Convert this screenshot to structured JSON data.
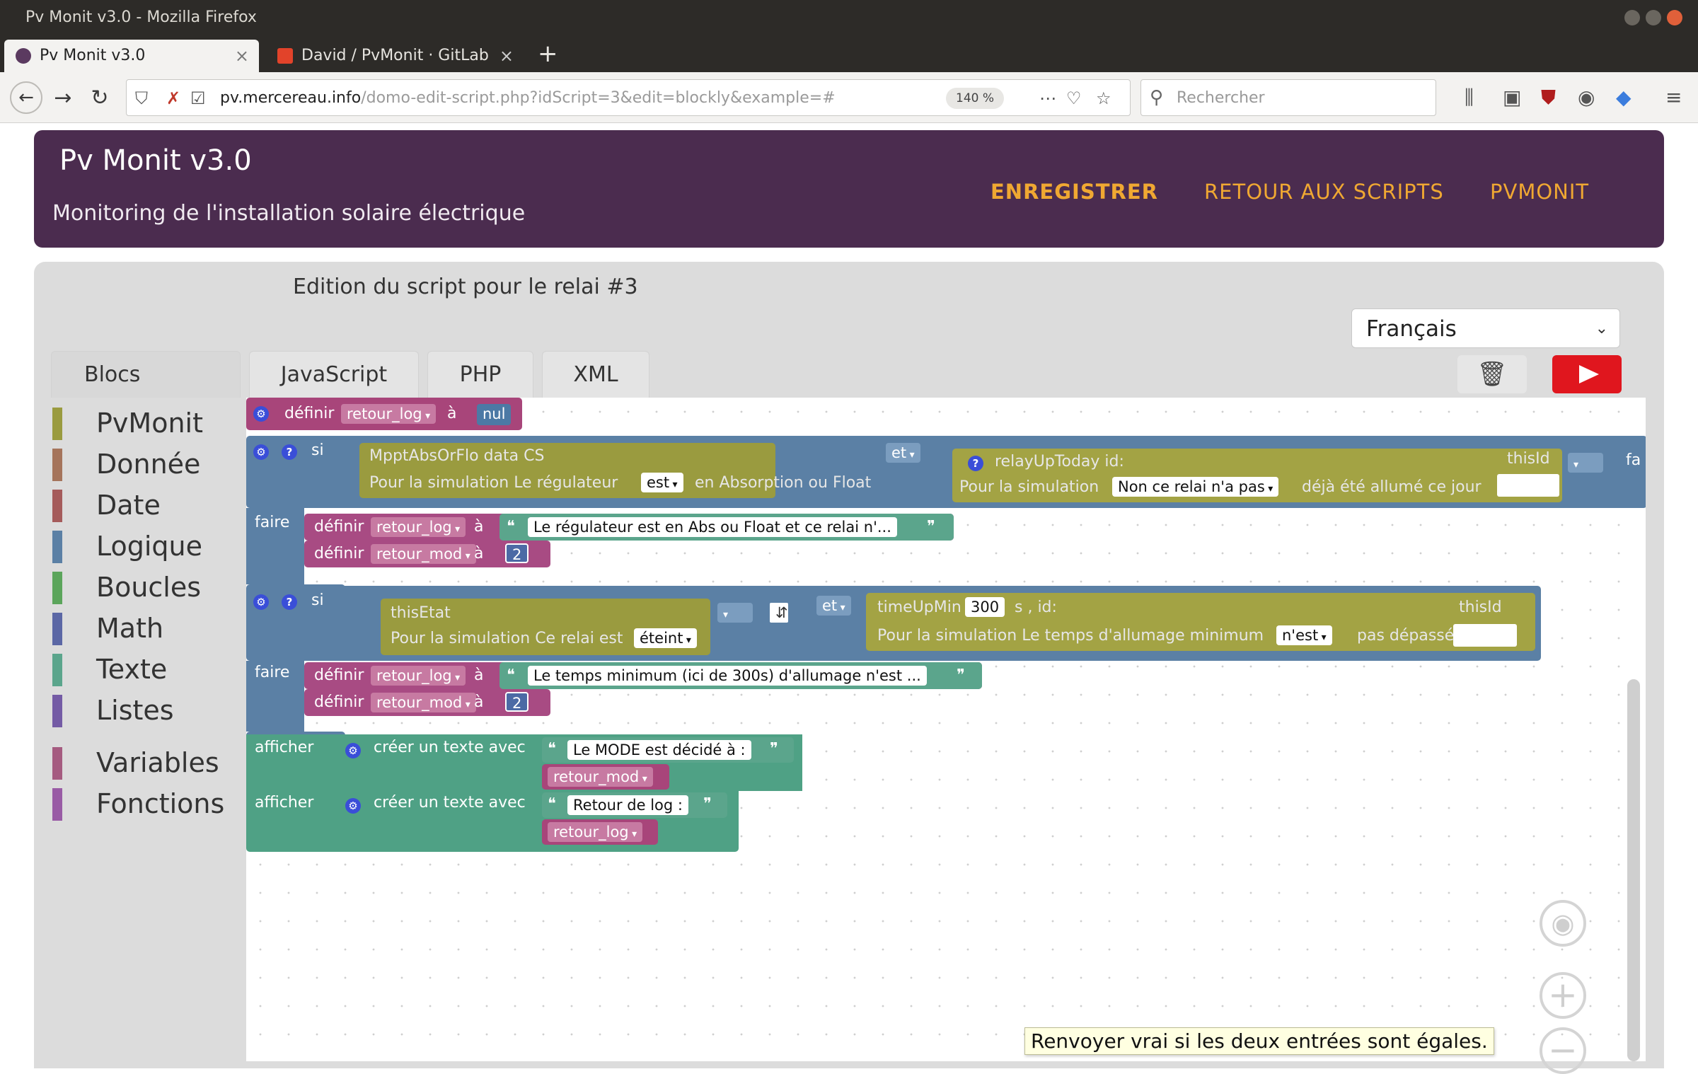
{
  "browser": {
    "window_title": "Pv Monit v3.0 - Mozilla Firefox",
    "tabs": [
      {
        "label": "Pv Monit v3.0",
        "active": true
      },
      {
        "label": "David / PvMonit · GitLab",
        "active": false
      }
    ],
    "url_domain": "pv.mercereau.info",
    "url_prefix": "",
    "url_path": "/domo-edit-script.php?idScript=3&edit=blockly&example=#",
    "zoom": "140 %",
    "search_placeholder": "Rechercher",
    "accent_colors": {
      "window_close": "#e0603a"
    }
  },
  "header": {
    "title": "Pv Monit v3.0",
    "subtitle": "Monitoring de l'installation solaire électrique",
    "nav": {
      "save": "ENREGISTRER",
      "back": "RETOUR AUX SCRIPTS",
      "home": "PVMONIT"
    },
    "bg_color": "#4b2c4f",
    "nav_color": "#f0a832"
  },
  "editor": {
    "script_title": "Edition du script pour le relai #3",
    "language": "Français",
    "tabs": {
      "blocs": "Blocs",
      "js": "JavaScript",
      "php": "PHP",
      "xml": "XML"
    },
    "run_color": "#e0161e"
  },
  "toolbox": {
    "categories": [
      {
        "label": "PvMonit",
        "color": "#9a9b3f"
      },
      {
        "label": "Donnée",
        "color": "#a5745b"
      },
      {
        "label": "Date",
        "color": "#a55b5b"
      },
      {
        "label": "Logique",
        "color": "#5b80a5"
      },
      {
        "label": "Boucles",
        "color": "#5ba55b"
      },
      {
        "label": "Math",
        "color": "#5b67a5"
      },
      {
        "label": "Texte",
        "color": "#5ba58c"
      },
      {
        "label": "Listes",
        "color": "#745ba5"
      },
      {
        "label": "Variables",
        "color": "#a55b80"
      },
      {
        "label": "Fonctions",
        "color": "#995ba5"
      }
    ]
  },
  "blocks": {
    "set1": {
      "definir": "définir",
      "var": "retour_log",
      "a": "à",
      "value": "nul"
    },
    "if1": {
      "si": "si",
      "faire": "faire",
      "cond_a_title": "MpptAbsOrFlo  data CS",
      "cond_a_sim_label": "Pour la simulation   Le régulateur",
      "cond_a_dd": "est",
      "cond_a_tail": "en Absorption ou Float",
      "op": "et",
      "cond_b_title": "relayUpToday   id:",
      "cond_b_thisid": "thisId",
      "cond_b_sim_label": "Pour la simulation",
      "cond_b_dd": "Non ce relai n'a pas",
      "cond_b_tail": "déjà été allumé ce jour",
      "cut_label": "fa",
      "set_log_text": "Le régulateur est en Abs ou Float et ce relai n'...",
      "set_log_var": "retour_log",
      "set_mod_var": "retour_mod",
      "set_mod_val": "2",
      "definir": "définir",
      "a": "à"
    },
    "if2": {
      "si": "si",
      "faire": "faire",
      "cond_a_title": "thisEtat",
      "cond_a_sim_label": "Pour la simulation   Ce relai est",
      "cond_a_dd": "éteint",
      "op": "et",
      "cond_b_title": "timeUpMin",
      "cond_b_num": "300",
      "cond_b_mid": "s  , id:",
      "cond_b_thisid": "thisId",
      "cond_b_sim_label": "Pour la simulation    Le temps d'allumage minimum",
      "cond_b_dd": "n'est",
      "cond_b_tail": "pas dépassé",
      "set_log_text": "Le temps minimum (ici de 300s) d'allumage n'est ...",
      "set_log_var": "retour_log",
      "set_mod_var": "retour_mod",
      "set_mod_val": "2",
      "definir": "définir",
      "a": "à"
    },
    "print1": {
      "afficher": "afficher",
      "create": "créer un texte avec",
      "text": "Le MODE est décidé à :",
      "var": "retour_mod"
    },
    "print2": {
      "afficher": "afficher",
      "create": "créer un texte avec",
      "text": "Retour de log :",
      "var": "retour_log"
    },
    "tooltip": "Renvoyer vrai si les deux entrées sont égales."
  }
}
